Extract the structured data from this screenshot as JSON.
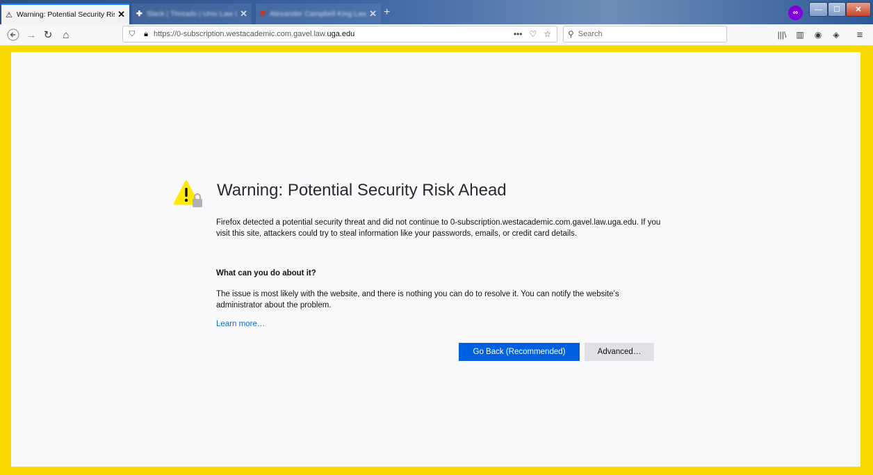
{
  "browser": {
    "tabs": [
      {
        "title": "Warning: Potential Security Risk",
        "close": "✕",
        "active": true
      },
      {
        "title": "Slack | Threads | Univ Law LLC",
        "close": "✕"
      },
      {
        "title": "Alexander Campbell King Law L",
        "close": "✕"
      }
    ],
    "new_tab": "+",
    "window_controls": {
      "minimize": "—",
      "maximize": "☐",
      "close": "✕"
    },
    "private_badge": "∞",
    "url": {
      "prefix": "https://0-subscription.westacademic.com.gavel.law.",
      "highlight": "uga.edu"
    },
    "url_actions": {
      "more": "•••",
      "pocket": "♡",
      "bookmark": "☆"
    },
    "search": {
      "placeholder": "Search"
    },
    "toolbar": {
      "library": "|||\\",
      "sidebar": "▥",
      "account": "◉",
      "shield": "◈",
      "menu": "≡"
    }
  },
  "page": {
    "title": "Warning: Potential Security Risk Ahead",
    "intro": "Firefox detected a potential security threat and did not continue to 0-subscription.westacademic.com.gavel.law.uga.edu. If you visit this site, attackers could try to steal information like your passwords, emails, or credit card details.",
    "what_heading": "What can you do about it?",
    "what_body": "The issue is most likely with the website, and there is nothing you can do to resolve it. You can notify the website’s administrator about the problem.",
    "learn_more": "Learn more…",
    "go_back": "Go Back (Recommended)",
    "advanced": "Advanced…"
  },
  "colors": {
    "frame": "#f9d900",
    "primary_button": "#0061e0",
    "link": "#0a6bd6",
    "warning": "#ffe900"
  }
}
